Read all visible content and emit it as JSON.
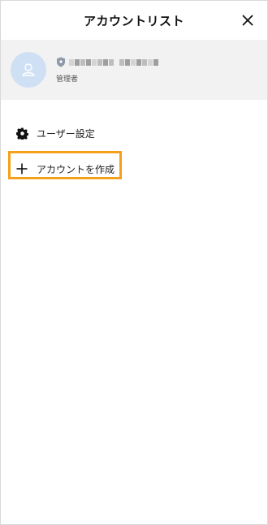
{
  "header": {
    "title": "アカウントリスト",
    "close_icon": "close-icon"
  },
  "account": {
    "avatar_icon": "user-avatar-icon",
    "badge_icon": "shield-icon",
    "name_redacted": true,
    "role": "管理者"
  },
  "menu": {
    "items": [
      {
        "label": "ユーザー設定",
        "icon": "gear-icon"
      },
      {
        "label": "アカウントを作成",
        "icon": "plus-icon",
        "highlighted": true
      }
    ]
  },
  "colors": {
    "avatar_bg": "#cfe0f5",
    "card_bg": "#f2f2f2",
    "highlight": "#f5a01a"
  }
}
